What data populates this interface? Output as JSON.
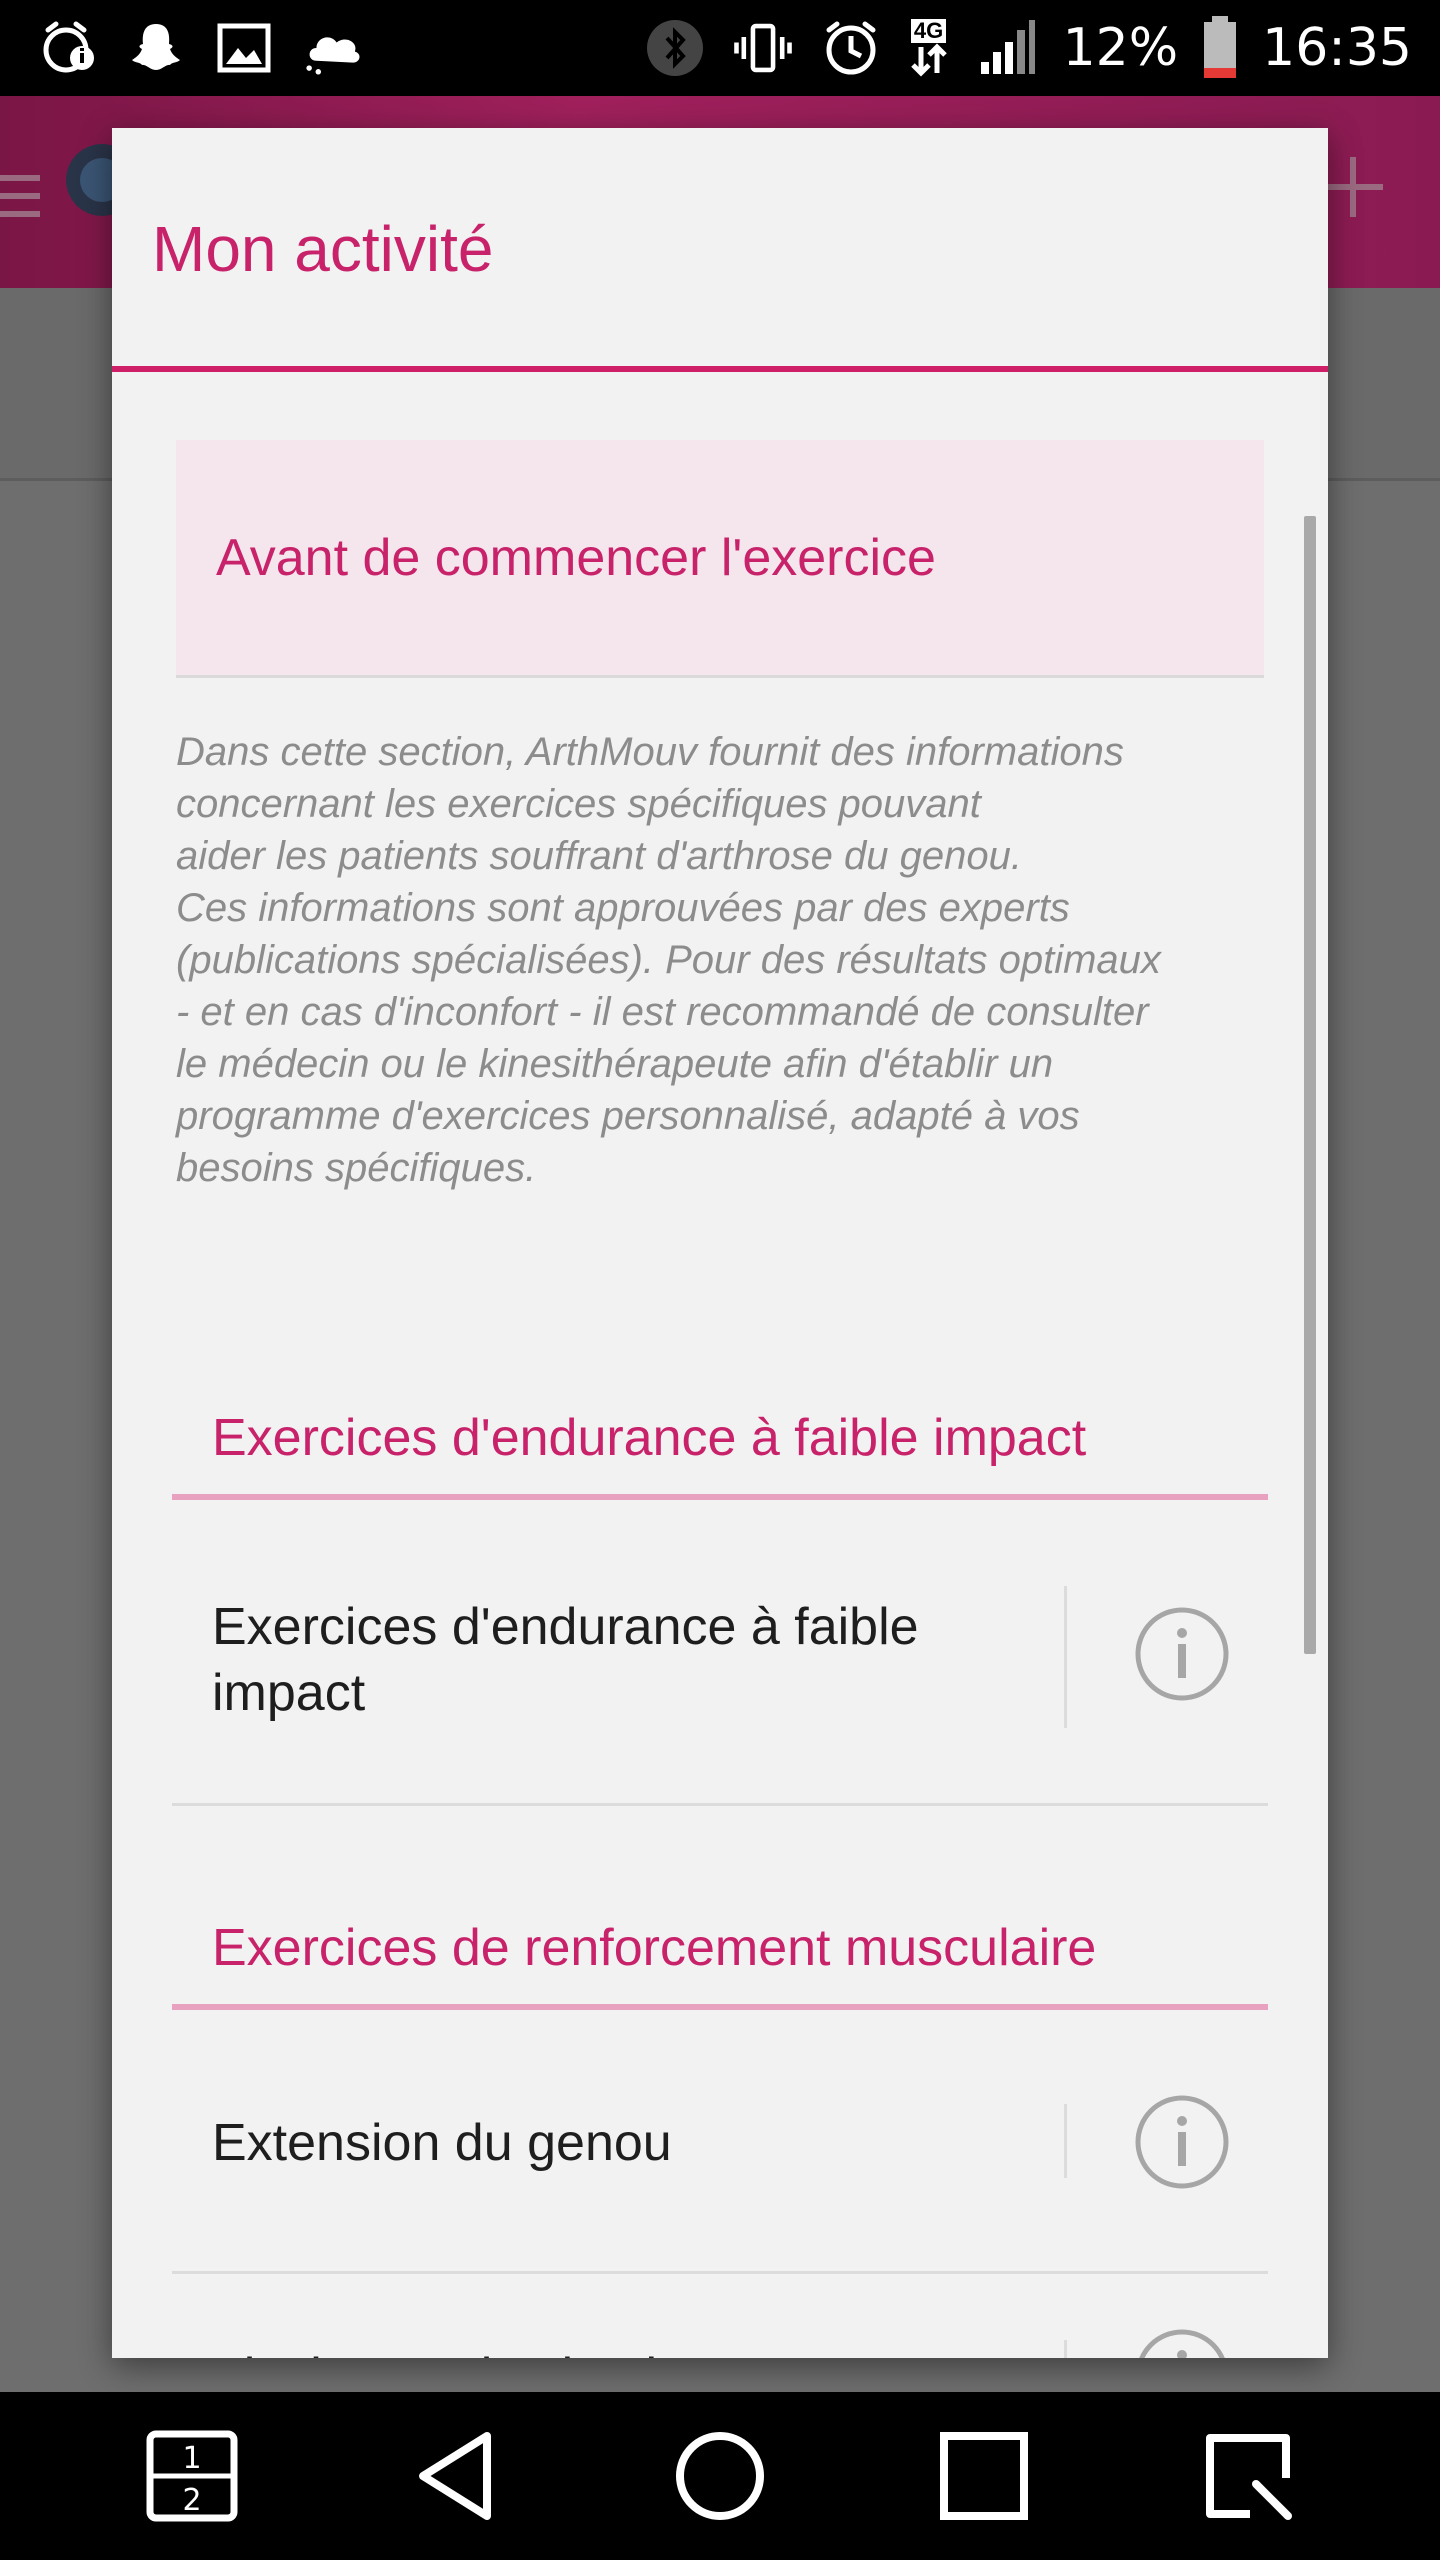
{
  "status_bar": {
    "battery_percent": "12%",
    "time": "16:35",
    "network_badge": "4G",
    "icons_left": [
      "alarm-info-icon",
      "snapchat-icon",
      "gallery-icon",
      "weather-icon"
    ],
    "icons_right": [
      "bluetooth-icon",
      "vibrate-icon",
      "alarm-icon",
      "data-arrows-icon",
      "signal-icon",
      "battery-icon"
    ]
  },
  "dialog": {
    "title": "Mon activité",
    "intro_banner": "Avant de commencer l'exercice",
    "description": "Dans cette section, ArthMouv fournit des informations\nconcernant les exercices spécifiques pouvant\naider les patients souffrant d'arthrose du genou.\nCes informations sont approuvées par des experts\n(publications spécialisées). Pour des résultats optimaux\n- et en cas d'inconfort - il est recommandé de consulter\nle médecin ou le kinesithérapeute afin d'établir un\nprogramme d'exercices personnalisé, adapté à vos\nbesoins spécifiques.",
    "sections": [
      {
        "label": "Exercices d'endurance à faible impact",
        "items": [
          {
            "label": "Exercices d'endurance à faible impact"
          }
        ]
      },
      {
        "label": "Exercices de renforcement musculaire",
        "items": [
          {
            "label": "Extension du genou"
          },
          {
            "label": "Flexion sur les jambes"
          }
        ]
      }
    ]
  },
  "colors": {
    "accent": "#c8226a",
    "section_underline": "#e8a2bf",
    "banner_bg": "#f4e6ec",
    "description_text": "#8c8c8c"
  },
  "nav_bar": {
    "icons": [
      "dual-window-icon",
      "back-icon",
      "home-icon",
      "recents-icon",
      "capture-icon"
    ],
    "dual_window_top": "1",
    "dual_window_bottom": "2"
  }
}
